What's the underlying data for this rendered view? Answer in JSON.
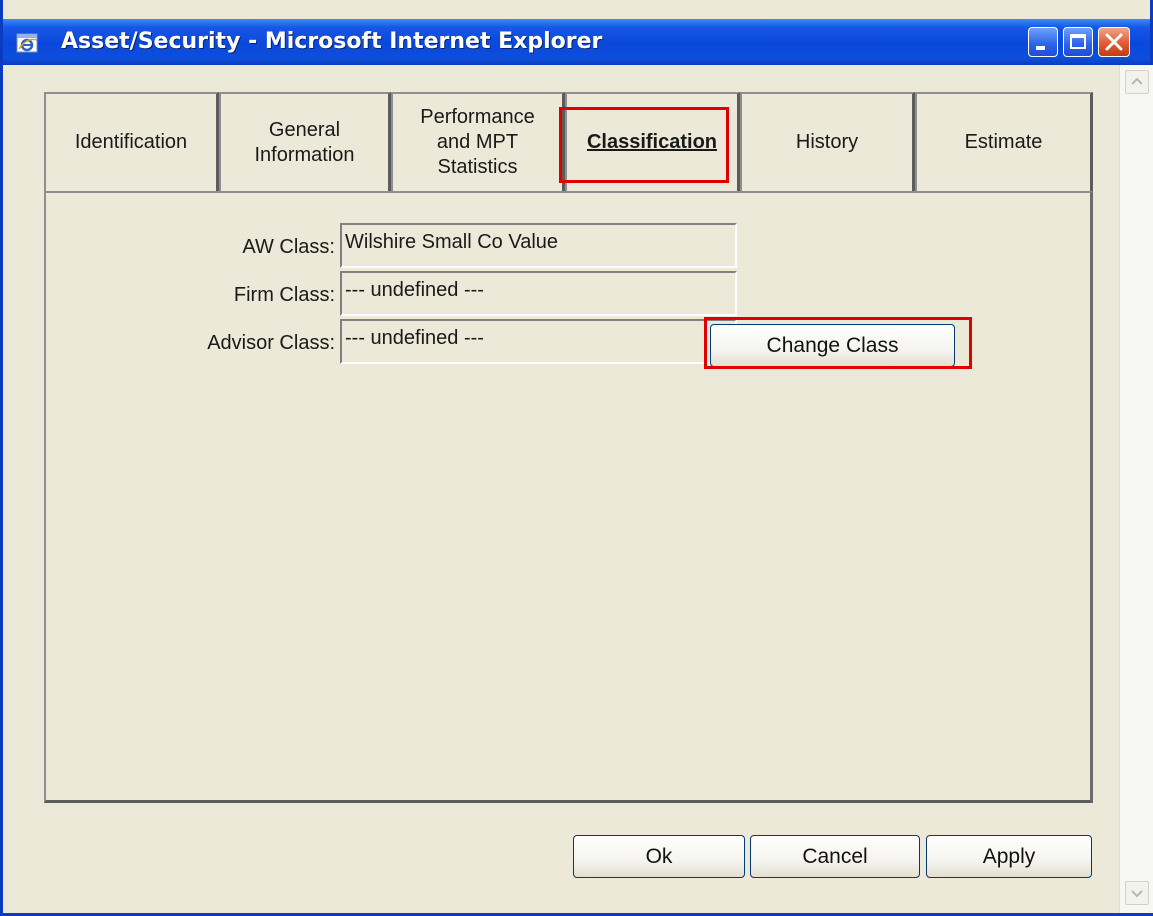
{
  "window": {
    "title": "Asset/Security - Microsoft Internet Explorer"
  },
  "tabs": [
    {
      "label": "Identification"
    },
    {
      "label": "General\nInformation"
    },
    {
      "label": "Performance\nand MPT\nStatistics"
    },
    {
      "label": "Classification"
    },
    {
      "label": "History"
    },
    {
      "label": "Estimate"
    }
  ],
  "fields": {
    "aw_class": {
      "label": "AW Class:",
      "value": "Wilshire Small Co Value"
    },
    "firm_class": {
      "label": "Firm Class:",
      "value": "--- undefined ---"
    },
    "advisor_class": {
      "label": "Advisor Class:",
      "value": "--- undefined ---"
    }
  },
  "buttons": {
    "change_class": "Change Class",
    "ok": "Ok",
    "cancel": "Cancel",
    "apply": "Apply"
  },
  "colors": {
    "highlight": "#e00000",
    "titlebar": "#0a48db",
    "face": "#ece9d8"
  }
}
